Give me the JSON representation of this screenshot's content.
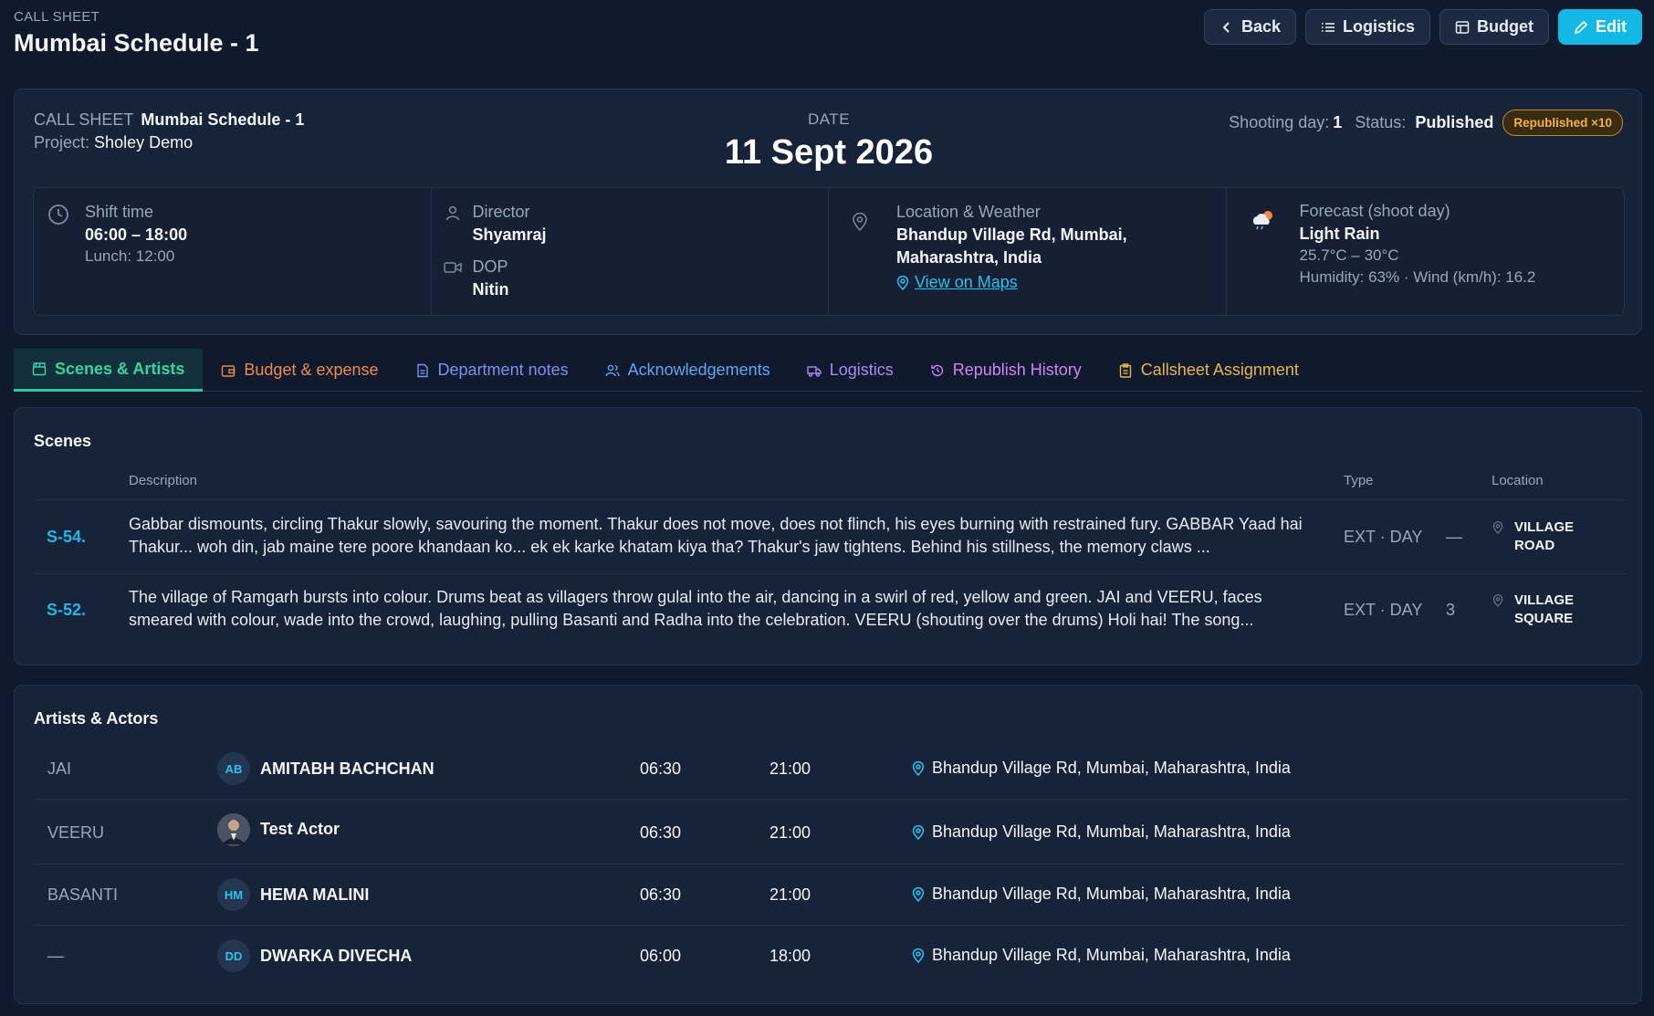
{
  "header": {
    "eyebrow": "CALL SHEET",
    "title": "Mumbai Schedule - 1",
    "actions": {
      "back": "Back",
      "logistics": "Logistics",
      "budget": "Budget",
      "edit": "Edit"
    }
  },
  "summary": {
    "callsheet_label": "CALL SHEET",
    "callsheet_name": "Mumbai Schedule - 1",
    "project_label": "Project:",
    "project_name": "Sholey Demo",
    "date_label": "DATE",
    "date_value": "11 Sept 2026",
    "shooting_day_label": "Shooting day:",
    "shooting_day_value": "1",
    "status_label": "Status:",
    "status_value": "Published",
    "republished_badge": "Republished ×10"
  },
  "info": {
    "shift": {
      "label": "Shift time",
      "time": "06:00 – 18:00",
      "lunch": "Lunch: 12:00"
    },
    "director": {
      "label": "Director",
      "name": "Shyamraj"
    },
    "dop": {
      "label": "DOP",
      "name": "Nitin"
    },
    "location": {
      "label": "Location & Weather",
      "address_line1": "Bhandup Village Rd, Mumbai,",
      "address_line2": "Maharashtra, India",
      "maps_link": "View on Maps"
    },
    "forecast": {
      "label": "Forecast (shoot day)",
      "condition": "Light Rain",
      "temp": "25.7°C – 30°C",
      "details": "Humidity: 63% · Wind (km/h): 16.2"
    }
  },
  "tabs": [
    {
      "label": "Scenes & Artists",
      "color": "#38d39f",
      "icon": "clapperboard-icon"
    },
    {
      "label": "Budget & expense",
      "color": "#f08a4b",
      "icon": "wallet-icon"
    },
    {
      "label": "Department notes",
      "color": "#7e8ff0",
      "icon": "document-icon"
    },
    {
      "label": "Acknowledgements",
      "color": "#5fa6f0",
      "icon": "users-icon"
    },
    {
      "label": "Logistics",
      "color": "#a98af5",
      "icon": "truck-icon"
    },
    {
      "label": "Republish History",
      "color": "#d184f0",
      "icon": "history-icon"
    },
    {
      "label": "Callsheet Assignment",
      "color": "#e8b54b",
      "icon": "clipboard-icon"
    }
  ],
  "scenes": {
    "title": "Scenes",
    "headers": {
      "description": "Description",
      "type": "Type",
      "location": "Location"
    },
    "rows": [
      {
        "id": "S-54.",
        "description": "Gabbar dismounts, circling Thakur slowly, savouring the moment. Thakur does not move, does not flinch, his eyes burning with restrained fury. GABBAR Yaad hai Thakur... woh din, jab maine tere poore khandaan ko... ek ek karke khatam kiya tha? Thakur's jaw tightens. Behind his stillness, the memory claws ...",
        "type": "EXT · DAY",
        "count": "—",
        "location_line1": "VILLAGE",
        "location_line2": "ROAD"
      },
      {
        "id": "S-52.",
        "description": "The village of Ramgarh bursts into colour. Drums beat as villagers throw gulal into the air, dancing in a swirl of red, yellow and green. JAI and VEERU, faces smeared with colour, wade into the crowd, laughing, pulling Basanti and Radha into the celebration. VEERU (shouting over the drums) Holi hai! The song...",
        "type": "EXT · DAY",
        "count": "3",
        "location_line1": "VILLAGE",
        "location_line2": "SQUARE"
      }
    ]
  },
  "artists": {
    "title": "Artists & Actors",
    "rows": [
      {
        "role": "JAI",
        "initials": "AB",
        "name": "AMITABH BACHCHAN",
        "in": "06:30",
        "out": "21:00",
        "location": "Bhandup Village Rd, Mumbai, Maharashtra, India"
      },
      {
        "role": "VEERU",
        "initials": "",
        "name": "Test Actor",
        "in": "06:30",
        "out": "21:00",
        "location": "Bhandup Village Rd, Mumbai, Maharashtra, India"
      },
      {
        "role": "BASANTI",
        "initials": "HM",
        "name": "HEMA MALINI",
        "in": "06:30",
        "out": "21:00",
        "location": "Bhandup Village Rd, Mumbai, Maharashtra, India"
      },
      {
        "role": "—",
        "initials": "DD",
        "name": "DWARKA DIVECHA",
        "in": "06:00",
        "out": "18:00",
        "location": "Bhandup Village Rd, Mumbai, Maharashtra, India"
      }
    ]
  }
}
